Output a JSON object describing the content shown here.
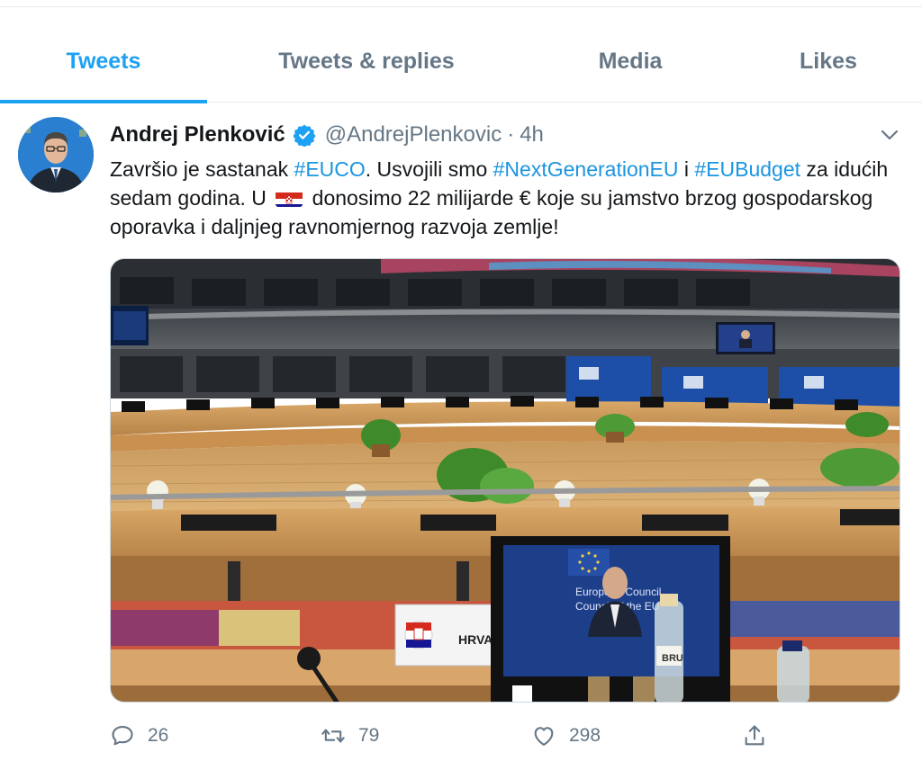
{
  "tabs": [
    {
      "label": "Tweets",
      "active": true
    },
    {
      "label": "Tweets & replies",
      "active": false
    },
    {
      "label": "Media",
      "active": false
    },
    {
      "label": "Likes",
      "active": false
    }
  ],
  "tweet": {
    "author_name": "Andrej Plenković",
    "handle": "@AndrejPlenkovic",
    "separator": "·",
    "time": "4h",
    "text": {
      "p1": "Završio je sastanak ",
      "tag1": "#EUCO",
      "p2": ". Usvojili smo ",
      "tag2": "#NextGenerationEU",
      "p3": " i ",
      "tag3": "#EUBudget",
      "p4": " za idućih sedam godina. U ",
      "p5": " donosimo 22 milijarde € koje su jamstvo brzog gospodarskog oporavka i daljnjeg ravnomjernog razvoja zemlje!"
    },
    "media": {
      "screen_text_1": "European Council",
      "screen_text_2": "Council of the EU",
      "nameplate": "HRVA",
      "bottle_label": "BRU"
    },
    "stats": {
      "replies": "26",
      "retweets": "79",
      "likes": "298"
    }
  },
  "colors": {
    "accent": "#1da1f2",
    "link": "#1b95e0",
    "muted": "#657786",
    "border": "#e6ecf0"
  }
}
